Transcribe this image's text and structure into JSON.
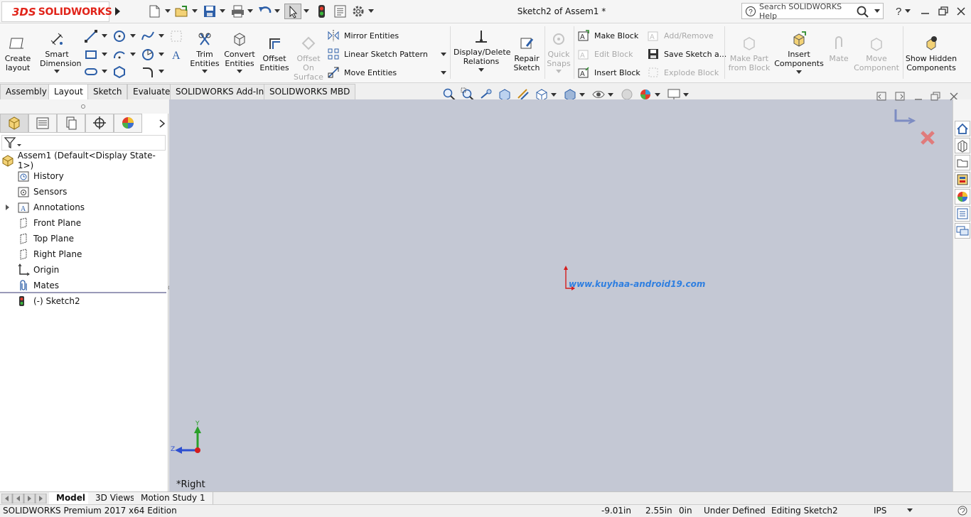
{
  "app": {
    "brand_prefix": "3DS",
    "brand_name": "SOLIDWORKS",
    "document_title": "Sketch2 of Assem1 *"
  },
  "search": {
    "placeholder": "Search SOLIDWORKS Help"
  },
  "ribbon": {
    "create_layout": "Create layout",
    "smart_dimension": "Smart Dimension",
    "trim_entities": "Trim Entities",
    "convert_entities": "Convert Entities",
    "offset_entities": "Offset Entities",
    "offset_on_surface": "Offset On Surface",
    "mirror_entities": "Mirror Entities",
    "linear_sketch_pattern": "Linear Sketch Pattern",
    "move_entities": "Move Entities",
    "display_delete_relations": "Display/Delete Relations",
    "repair_sketch": "Repair Sketch",
    "quick_snaps": "Quick Snaps",
    "make_block": "Make Block",
    "edit_block": "Edit Block",
    "insert_block": "Insert Block",
    "add_remove": "Add/Remove",
    "save_sketch_as": "Save Sketch a...",
    "explode_block": "Explode Block",
    "make_part_from_block": "Make Part from Block",
    "insert_components": "Insert Components",
    "mate": "Mate",
    "move_component": "Move Component",
    "show_hidden_components": "Show Hidden Components"
  },
  "tabs": [
    "Assembly",
    "Layout",
    "Sketch",
    "Evaluate",
    "SOLIDWORKS Add-Ins",
    "SOLIDWORKS MBD"
  ],
  "active_tab": "Layout",
  "feature_tree": {
    "root": "Assem1  (Default<Display State-1>)",
    "items": [
      "History",
      "Sensors",
      "Annotations",
      "Front Plane",
      "Top Plane",
      "Right Plane",
      "Origin",
      "Mates",
      "(-) Sketch2"
    ]
  },
  "viewport": {
    "view_label": "*Right",
    "watermark": "www.kuyhaa-android19.com",
    "triad_y": "Y",
    "triad_z": "Z"
  },
  "bottom_tabs": [
    "Model",
    "3D Views",
    "Motion Study 1"
  ],
  "active_bottom_tab": "Model",
  "status": {
    "product": "SOLIDWORKS Premium 2017 x64 Edition",
    "x": "-9.01in",
    "y": "2.55in",
    "z": "0in",
    "definition": "Under Defined",
    "editing": "Editing Sketch2",
    "units": "IPS"
  },
  "colors": {
    "brand": "#e1251b",
    "viewport_bg": "#c4c8d4",
    "watermark": "#2f7fe0"
  }
}
